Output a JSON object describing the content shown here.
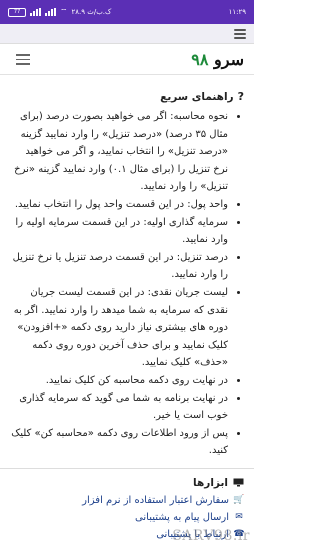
{
  "status_bar": {
    "time": "۱۱:۲۹",
    "network_speed": "۲۸.۹ ک.ب/ث",
    "battery": "77"
  },
  "app": {
    "logo_text": "سرو",
    "logo_number": "۹۸"
  },
  "guide": {
    "title": "راهنمای سریع",
    "items": [
      "نحوه محاسبه: اگر می خواهید بصورت درصد (برای مثال ۳۵ درصد) «درصد تنزیل» را وارد نمایید گزینه «درصد تنزیل» را انتخاب نمایید، و اگر می خواهید نرخ تنزیل را (برای مثال ۰.۱) وارد نمایید گزینه «نرخ تنزیل» را وارد نمایید.",
      "واحد پول: در این قسمت واحد پول را انتخاب نمایید.",
      "سرمایه گذاری اولیه: در این قسمت سرمایه اولیه را وارد نمایید.",
      "درصد تنزیل: در این قسمت درصد تنزیل یا نرخ تنزیل را وارد نمایید.",
      "لیست جریان نقدی: در این قسمت لیست جریان نقدی که سرمایه به شما میدهد را وارد نمایید. اگر به دوره های بیشتری نیاز دارید روی دکمه «+افزودن» کلیک نمایید و برای حذف آخرین دوره روی دکمه «حذف» کلیک نمایید.",
      "در نهایت روی دکمه محاسبه کن کلیک نمایید.",
      "در نهایت برنامه به شما می گوید که سرمایه گذاری خوب است یا خیر.",
      "پس از ورود اطلاعات روی دکمه «محاسبه کن» کلیک کنید."
    ]
  },
  "tools": {
    "title": "ابزارها",
    "links": [
      {
        "label": "سفارش اعتبار استفاده از نرم افزار",
        "icon": "cart-icon"
      },
      {
        "label": "ارسال پیام به پشتیبانی",
        "icon": "envelope-icon"
      },
      {
        "label": "ارتباط با پشتیبانی",
        "icon": "phone-icon"
      }
    ]
  },
  "watermark": "SARV98.ir",
  "colors": {
    "status_bar": "#5b2fb5",
    "logo_number": "#1d8a3a",
    "link": "#1c3f8a"
  }
}
